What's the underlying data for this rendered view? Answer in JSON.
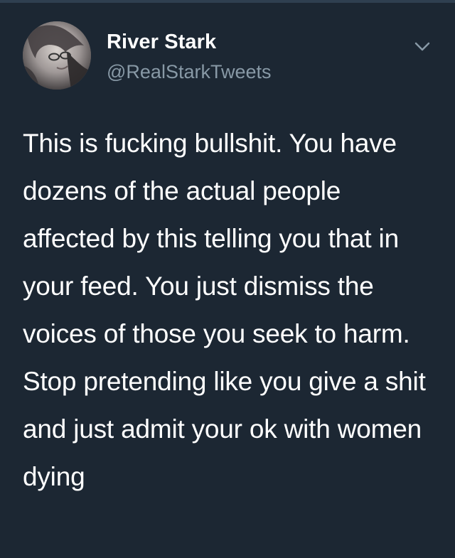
{
  "user": {
    "name": "River Stark",
    "handle": "@RealStarkTweets",
    "avatar_icon": "profile-photo"
  },
  "menu": {
    "icon": "chevron-down-icon"
  },
  "tweet": {
    "text": "This is fucking bullshit. You have dozens of the actual people affected by this telling you that in your feed. You just dismiss the voices of those you seek to harm. Stop pretending like you give a shit and just admit your ok with women dying"
  },
  "colors": {
    "background": "#1c2733",
    "text_primary": "#ffffff",
    "text_secondary": "#8899a6"
  }
}
